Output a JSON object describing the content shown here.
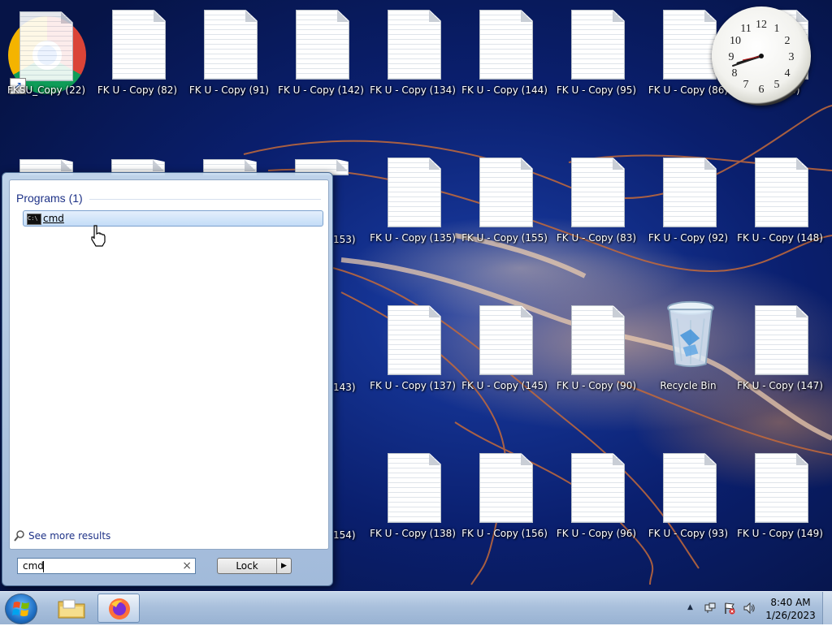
{
  "desktop": {
    "top_row_first_label": "FKSU_Copy (22)",
    "row1": [
      "FK U - Copy (82)",
      "FK U - Copy (91)",
      "FK U - Copy (142)",
      "FK U - Copy (134)",
      "FK U - Copy (144)",
      "FK U - Copy (95)",
      "FK U - Copy (86)",
      "146)"
    ],
    "row2": [
      "153)",
      "FK U - Copy (135)",
      "FK U - Copy (155)",
      "FK U - Copy (83)",
      "FK U - Copy (92)",
      "FK U - Copy (148)"
    ],
    "row3": [
      "143)",
      "FK U - Copy (137)",
      "FK U - Copy (145)",
      "FK U - Copy (90)",
      "Recycle Bin",
      "FK U - Copy (147)"
    ],
    "row4": [
      "154)",
      "FK U - Copy (138)",
      "FK U - Copy (156)",
      "FK U - Copy (96)",
      "FK U - Copy (93)",
      "FK U - Copy (149)"
    ]
  },
  "clock": {
    "numbers": [
      "12",
      "1",
      "2",
      "3",
      "4",
      "5",
      "6",
      "7",
      "8",
      "9",
      "10",
      "11"
    ]
  },
  "start_menu": {
    "section_title": "Programs (1)",
    "result_label": "cmd",
    "see_more": "See more results",
    "search_value": "cmd",
    "clear_glyph": "×",
    "lock_label": "Lock",
    "lock_arrow": "▶"
  },
  "taskbar": {
    "time": "8:40 AM",
    "date": "1/26/2023",
    "tray_up": "▲"
  },
  "icons": {
    "start": "windows-start-orb",
    "explorer": "folder-icon",
    "firefox": "firefox-icon",
    "volume": "speaker-icon",
    "network": "network-icon",
    "action_center": "flag-icon"
  }
}
